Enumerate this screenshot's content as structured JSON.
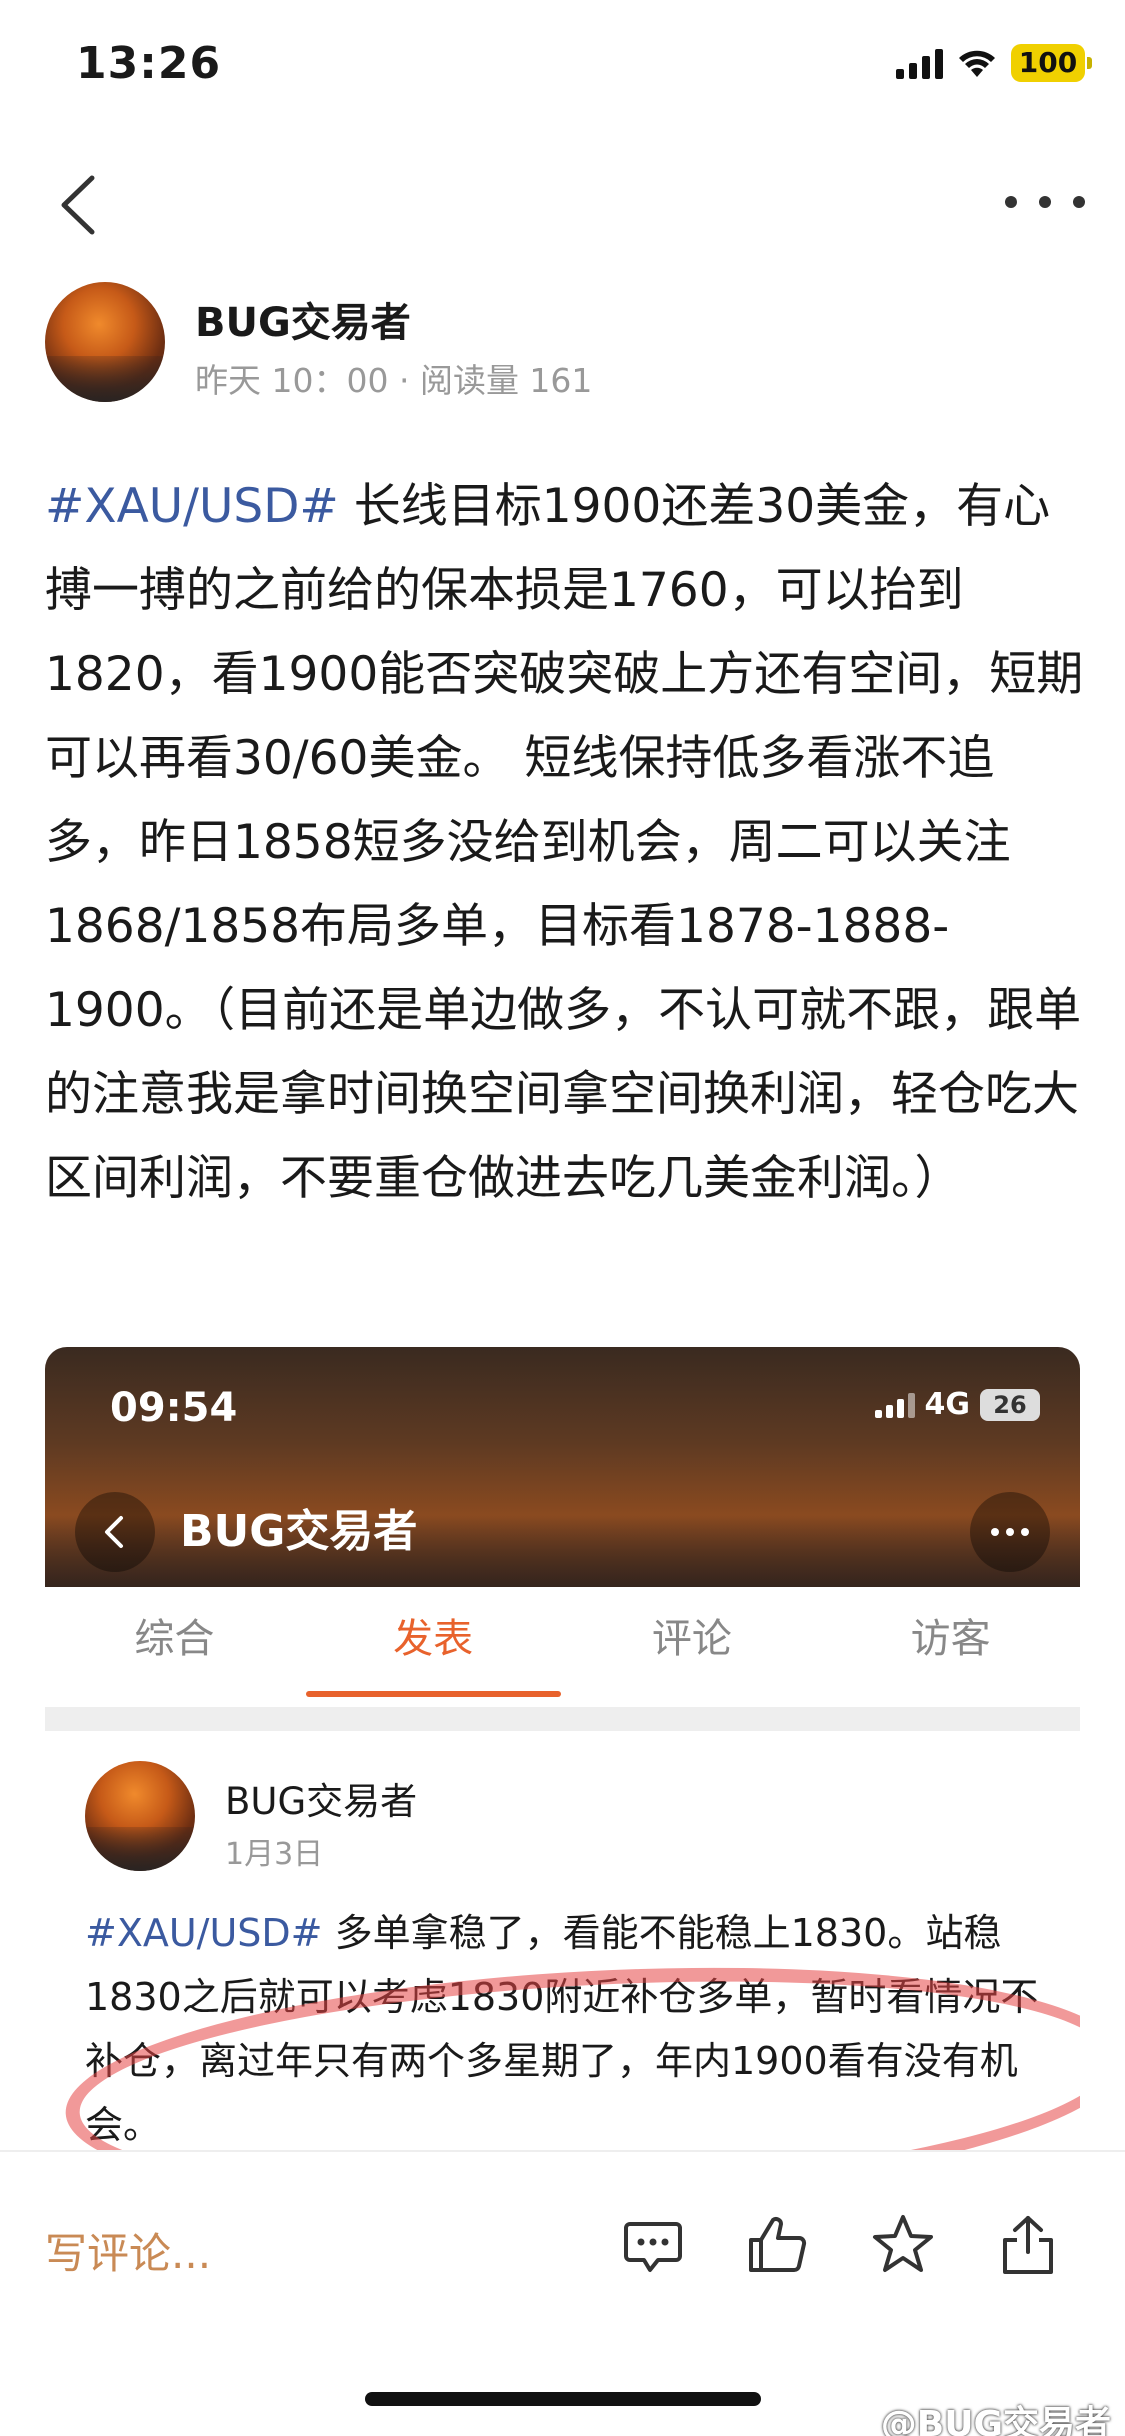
{
  "status_bar": {
    "time": "13:26",
    "battery": "100"
  },
  "author": {
    "name": "BUG交易者",
    "meta": "昨天 10：00 · 阅读量 161"
  },
  "post": {
    "hashtag": "#XAU/USD#",
    "text": " 长线目标1900还差30美金，有心搏一搏的之前给的保本损是1760，可以抬到1820，看1900能否突破突破上方还有空间，短期可以再看30/60美金。 短线保持低多看涨不追多，昨日1858短多没给到机会，周二可以关注1868/1858布局多单，目标看1878-1888-1900。（目前还是单边做多，不认可就不跟，跟单的注意我是拿时间换空间拿空间换利润，轻仓吃大区间利润，不要重仓做进去吃几美金利润。）"
  },
  "embed": {
    "time": "09:54",
    "network": "4G",
    "battery": "26",
    "title": "BUG交易者",
    "tabs": [
      {
        "label": "综合"
      },
      {
        "label": "发表"
      },
      {
        "label": "评论"
      },
      {
        "label": "访客"
      }
    ],
    "post": {
      "author": "BUG交易者",
      "date": "1月3日",
      "hashtag": "#XAU/USD#",
      "text": " 多单拿稳了，看能不能稳上1830。站稳1830之后就可以考虑1830附近补仓多单，暂时看情况不补仓，离过年只有两个多星期了，年内1900看有没有机会。"
    }
  },
  "bottom_bar": {
    "comment_placeholder": "写评论...",
    "actions": [
      "comment-icon",
      "like-icon",
      "star-icon",
      "share-icon"
    ]
  },
  "watermark": "@BUG交易者",
  "colors": {
    "hashtag": "#3b5aa0",
    "accent": "#e8622c",
    "comment_hint": "#c98a55"
  }
}
